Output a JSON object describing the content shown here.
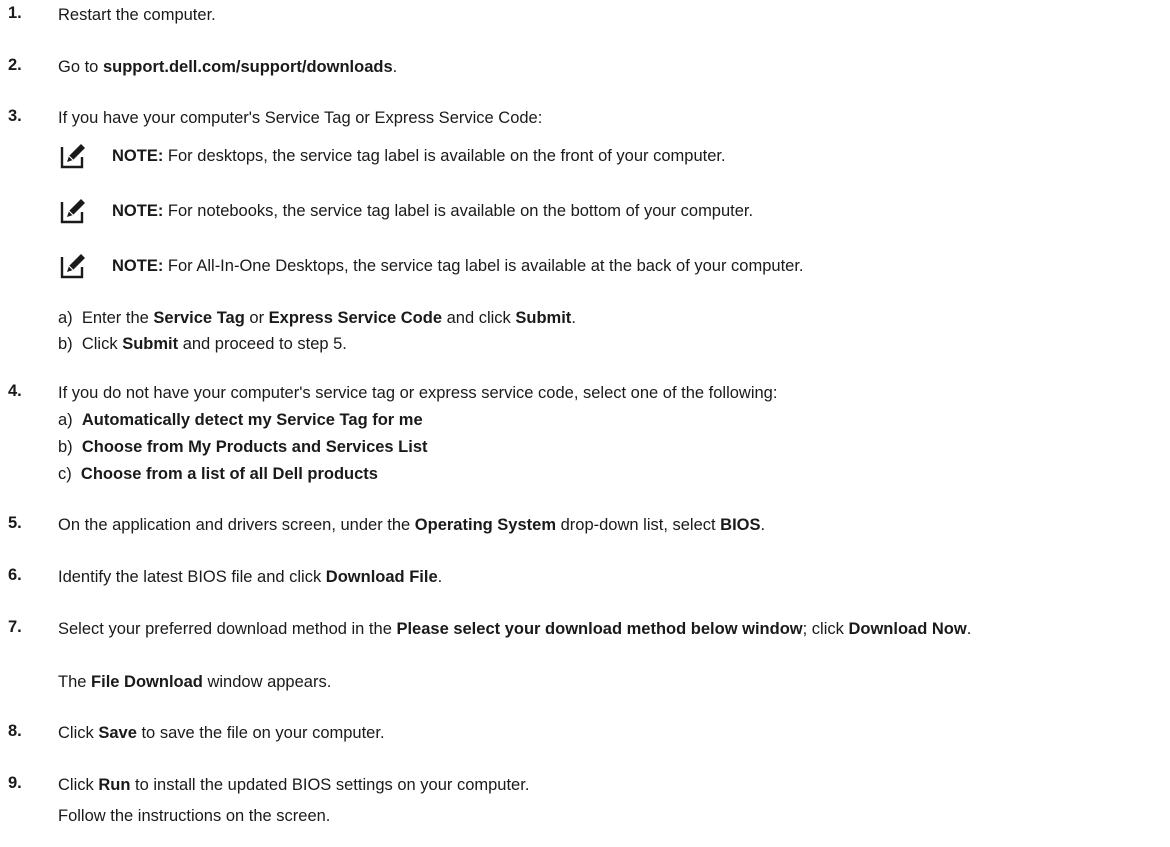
{
  "steps": {
    "s1": {
      "num": "1.",
      "text": "Restart the computer."
    },
    "s2": {
      "num": "2.",
      "pre": "Go to ",
      "link": "support.dell.com/support/downloads",
      "post": "."
    },
    "s3": {
      "num": "3.",
      "text": "If you have your computer's Service Tag or Express Service Code:"
    },
    "s4": {
      "num": "4.",
      "text": "If you do not have your computer's service tag or express service code, select one of the following:"
    },
    "s5": {
      "num": "5.",
      "pre": "On the application and drivers screen, under the ",
      "b1": "Operating System",
      "mid": " drop-down list, select ",
      "b2": "BIOS",
      "post": "."
    },
    "s6": {
      "num": "6.",
      "pre": "Identify the latest BIOS file and click ",
      "b1": "Download File",
      "post": "."
    },
    "s7": {
      "num": "7.",
      "pre": "Select your preferred download method in the ",
      "b1": "Please select your download method below window",
      "mid": "; click ",
      "b2": "Download Now",
      "post": ".",
      "result_pre": "The ",
      "result_b": "File Download",
      "result_post": " window appears."
    },
    "s8": {
      "num": "8.",
      "pre": "Click ",
      "b1": "Save",
      "post": " to save the file on your computer."
    },
    "s9": {
      "num": "9.",
      "pre": "Click ",
      "b1": "Run",
      "post": " to install the updated BIOS settings on your computer.",
      "result": "Follow the instructions on the screen."
    }
  },
  "notes": [
    {
      "label": "NOTE:",
      "text": " For desktops, the service tag label is available on the front of your computer."
    },
    {
      "label": "NOTE:",
      "text": " For notebooks, the service tag label is available on the bottom of your computer."
    },
    {
      "label": "NOTE:",
      "text": " For All-In-One Desktops, the service tag label is available at the back of your computer."
    }
  ],
  "substeps3": {
    "a": {
      "letter": "a)",
      "pre": "Enter the ",
      "b1": "Service Tag",
      "mid": " or ",
      "b2": "Express Service Code",
      "mid2": " and click ",
      "b3": "Submit",
      "post": "."
    },
    "b": {
      "letter": "b)",
      "pre": "Click ",
      "b1": "Submit",
      "post": " and proceed to step 5."
    }
  },
  "substeps4": [
    {
      "letter": "a)",
      "text": "Automatically detect my Service Tag for me"
    },
    {
      "letter": "b)",
      "text": "Choose from My Products and Services List"
    },
    {
      "letter": "c)",
      "text": "Choose from a list of all Dell products"
    }
  ],
  "icons": {
    "note": "pencil-note-icon"
  }
}
